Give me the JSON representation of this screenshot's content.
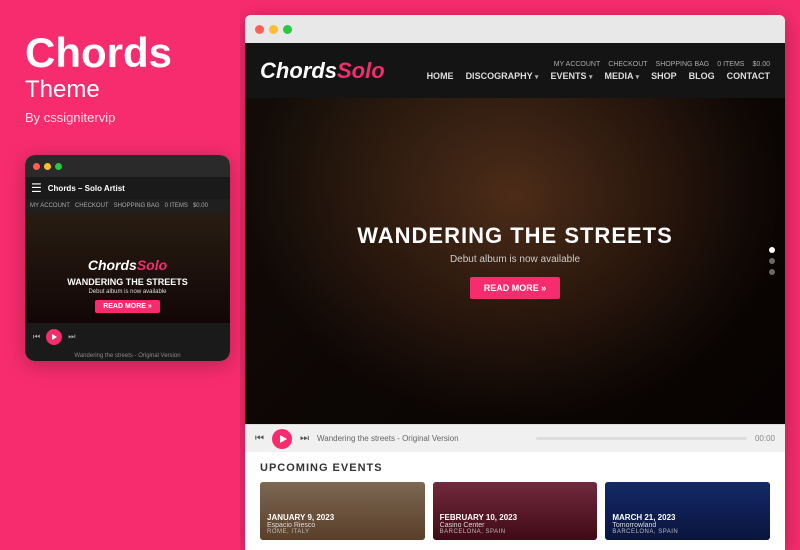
{
  "left": {
    "title": "Chords",
    "subtitle": "Theme",
    "byline": "By cssignitervip"
  },
  "mobile": {
    "dots": [
      "red",
      "yellow",
      "green"
    ],
    "nav_title": "Chords – Solo Artist",
    "top_links": [
      "MY ACCOUNT",
      "CHECKOUT",
      "SHOPPING BAG",
      "0 ITEMS",
      "$0.00"
    ],
    "logo_text": "Chords",
    "logo_span": "Solo",
    "hero_title": "WANDERING THE STREETS",
    "hero_sub": "Debut album is now available",
    "read_more": "READ MORE »",
    "player_track": "Wandering the streets - Original Version"
  },
  "browser": {
    "dots": [
      "red",
      "yellow",
      "green"
    ]
  },
  "site": {
    "logo_text": "Chords",
    "logo_span": "Solo",
    "top_links": [
      "MY ACCOUNT",
      "CHECKOUT",
      "SHOPPING BAG",
      "0 ITEMS",
      "$0.00"
    ],
    "nav": [
      {
        "label": "HOME"
      },
      {
        "label": "DISCOGRAPHY",
        "arrow": "▾"
      },
      {
        "label": "EVENTS",
        "arrow": "▾"
      },
      {
        "label": "MEDIA",
        "arrow": "▾"
      },
      {
        "label": "SHOP"
      },
      {
        "label": "BLOG"
      },
      {
        "label": "CONTACT"
      }
    ]
  },
  "hero": {
    "title": "WANDERING THE STREETS",
    "subtitle": "Debut album is now available",
    "button": "READ MORE »",
    "dots": [
      true,
      false,
      false
    ]
  },
  "player": {
    "track": "Wandering the streets - Original Version",
    "time": "00:00"
  },
  "events": {
    "section_title": "UPCOMING EVENTS",
    "cards": [
      {
        "date": "JANUARY 9, 2023",
        "venue": "Espacio Riesco",
        "location": "ROME, ITALY"
      },
      {
        "date": "FEBRUARY 10, 2023",
        "venue": "Casino Center",
        "location": "BARCELONA, SPAIN"
      },
      {
        "date": "MARCH 21, 2023",
        "venue": "Tomorrowland",
        "location": "BARCELONA, SPAIN"
      }
    ]
  }
}
